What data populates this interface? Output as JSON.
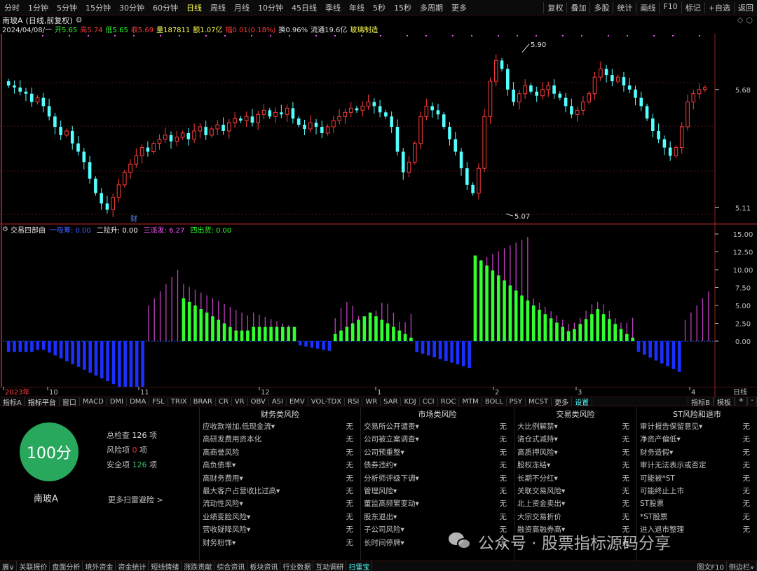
{
  "topbar": {
    "periods": [
      "分时",
      "1分钟",
      "5分钟",
      "15分钟",
      "30分钟",
      "60分钟",
      "日线",
      "周线",
      "月线",
      "10分钟",
      "45日线",
      "季线",
      "年线",
      "5秒",
      "15秒",
      "多周期",
      "更多"
    ],
    "selected_index": 6,
    "right_buttons": [
      "复权",
      "叠加",
      "多股",
      "统计",
      "画线",
      "F10",
      "标记",
      "+自选",
      "返回"
    ]
  },
  "title": {
    "name": "南玻A",
    "period": "(日线,前复权)"
  },
  "ohlc": {
    "date": "2024/04/08/一",
    "open": "开5.65",
    "high": "高5.74",
    "low": "低5.65",
    "close": "收5.69",
    "volume": "量187811",
    "amount": "额1.07亿",
    "change": "幅0.01(0.18%)",
    "turnover": "换0.96%",
    "float": "流通19.6亿",
    "sector": "玻璃制造"
  },
  "kline": {
    "ylabels": [
      "5.68",
      "5.11"
    ],
    "high_mark": "5.90",
    "low_mark": "5.07",
    "event_mark": "财",
    "colors": {
      "up": "#ff3c3c",
      "down": "#54ffff",
      "grid": "#5a1414",
      "axis": "#9a2020",
      "marker": "#ff54ff"
    }
  },
  "indicator": {
    "name": "交易四部曲",
    "params": [
      {
        "label": "一吸筹:",
        "value": "0.00",
        "color": "#4060ff"
      },
      {
        "label": "二拉升:",
        "value": "0.00",
        "color": "#ffffff"
      },
      {
        "label": "三派发:",
        "value": "6.27",
        "color": "#ff54ff"
      },
      {
        "label": "四出货:",
        "value": "0.00",
        "color": "#30ff30"
      }
    ],
    "ylabels": [
      "15.00",
      "12.50",
      "10.00",
      "7.50",
      "5.00",
      "2.50",
      "0.00"
    ]
  },
  "timeaxis": {
    "labels": [
      "2023年",
      "10",
      "11",
      "12",
      "1",
      "2",
      "3",
      "4"
    ],
    "right_label": "日线"
  },
  "tabs": {
    "items": [
      "指标A",
      "指标平台",
      "窗口",
      "MACD",
      "DMI",
      "DMA",
      "FSL",
      "TRIX",
      "BRAR",
      "CR",
      "VR",
      "OBV",
      "ASI",
      "EMV",
      "VOL-TDX",
      "RSI",
      "WR",
      "SAR",
      "KDJ",
      "CCI",
      "ROC",
      "MTM",
      "BOLL",
      "PSY",
      "MCST",
      "更多",
      "设置"
    ],
    "right_items": [
      "指标B",
      "模板",
      "+",
      "-"
    ]
  },
  "scan": {
    "score": "100分",
    "stock_name": "南玻A",
    "stats": [
      {
        "label": "总检查",
        "value": "126",
        "unit": "项"
      },
      {
        "label": "风险项",
        "value": "0",
        "unit": "项"
      },
      {
        "label": "安全项",
        "value": "126",
        "unit": "项"
      }
    ],
    "more": "更多扫雷避险 >",
    "columns": [
      {
        "title": "财务类风险",
        "rows": [
          [
            "应收款增加,低现金流▾",
            "无"
          ],
          [
            "高研发费用资本化",
            "无"
          ],
          [
            "高商誉风险",
            "无"
          ],
          [
            "高负债率▾",
            "无"
          ],
          [
            "高财务费用▾",
            "无"
          ],
          [
            "最大客户占营收比过高▾",
            "无"
          ],
          [
            "流动性风险▾",
            "无"
          ],
          [
            "业绩变脸风险▾",
            "无"
          ],
          [
            "营收疑降风险▾",
            "无"
          ],
          [
            "财务粉饰▾",
            "无"
          ]
        ]
      },
      {
        "title": "市场类风险",
        "rows": [
          [
            "交易所公开谴责▾",
            "无"
          ],
          [
            "公司被立案调查▾",
            "无"
          ],
          [
            "公司预重整▾",
            "无"
          ],
          [
            "债券违约▾",
            "无"
          ],
          [
            "分析师评级下调▾",
            "无"
          ],
          [
            "管理风险▾",
            "无"
          ],
          [
            "董监高频繁变动▾",
            "无"
          ],
          [
            "股东退出▾",
            "无"
          ],
          [
            "子公司风险▾",
            "无"
          ],
          [
            "长时间停牌▾",
            "无"
          ]
        ]
      },
      {
        "title": "交易类风险",
        "rows": [
          [
            "大比例解禁▾",
            "无"
          ],
          [
            "清仓式减持▾",
            "无"
          ],
          [
            "高质押风险▾",
            "无"
          ],
          [
            "股权冻结▾",
            "无"
          ],
          [
            "长期不分红▾",
            "无"
          ],
          [
            "关联交易风险▾",
            "无"
          ],
          [
            "北上资金卖出▾",
            "无"
          ],
          [
            "大宗交易折价",
            "无"
          ],
          [
            "融资高融券高▾",
            "无"
          ],
          [
            "...",
            "无"
          ]
        ]
      },
      {
        "title": "ST风险和退市",
        "rows": [
          [
            "审计报告保留意见▾",
            "无"
          ],
          [
            "净资产偏低▾",
            "无"
          ],
          [
            "财务造假▾",
            "无"
          ],
          [
            "审计无法表示或否定",
            "无"
          ],
          [
            "可能被*ST",
            "无"
          ],
          [
            "可能终止上市",
            "无"
          ],
          [
            "ST股票",
            "无"
          ],
          [
            "*ST股票",
            "无"
          ],
          [
            "进入退市整理",
            "无"
          ]
        ]
      }
    ]
  },
  "bottombar": {
    "items": [
      "展∨",
      "关联报价",
      "盘面分析",
      "境外资金",
      "资金统计",
      "短线情绪",
      "涨跌贡献",
      "综合资讯",
      "板块资讯",
      "行业数据",
      "互动调研",
      "扫雷宝"
    ],
    "active_index": 11,
    "right_items": [
      "图文F10",
      "侧边栏»"
    ]
  },
  "watermark": "公众号 · 股票指标源码分享"
}
